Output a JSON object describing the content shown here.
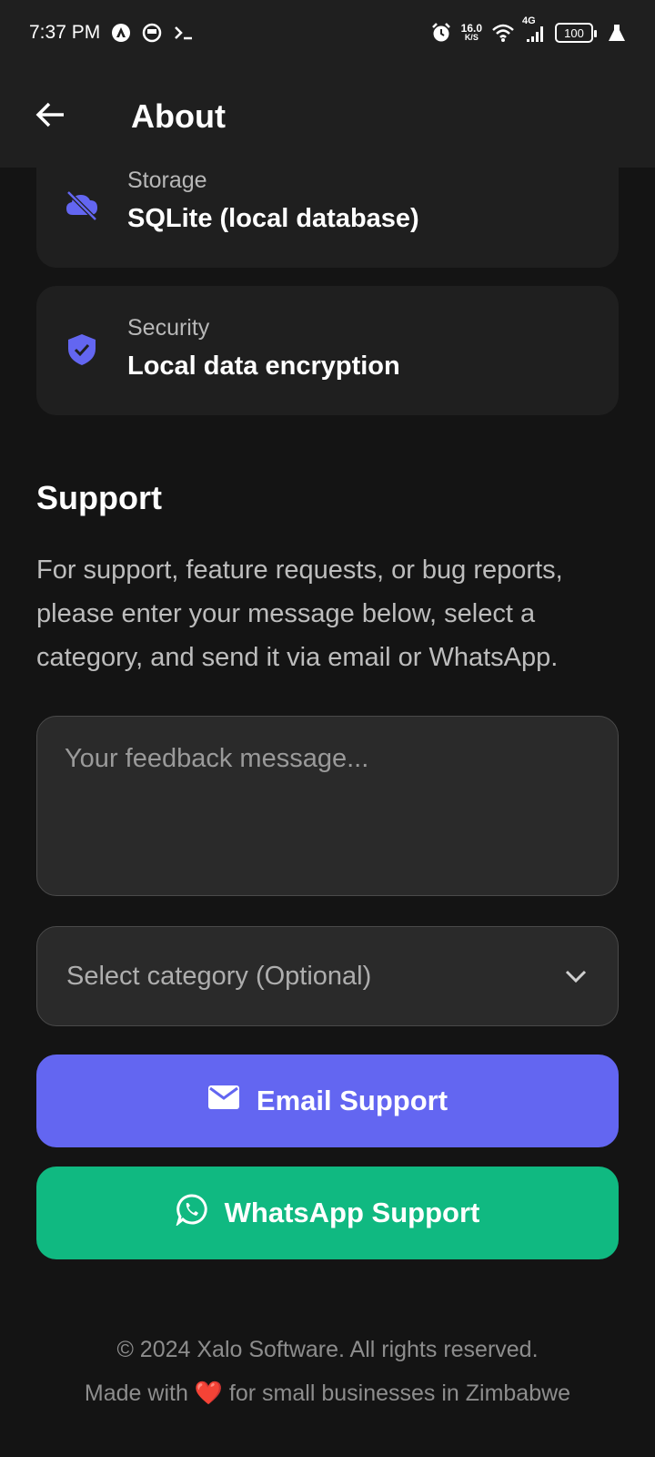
{
  "status_bar": {
    "time": "7:37 PM",
    "net_speed_value": "16.0",
    "net_speed_unit": "K/S",
    "network_type": "4G",
    "battery": "100",
    "icons": [
      "android-auto-icon",
      "app-notification-icon",
      "terminal-icon",
      "alarm-icon",
      "wifi-icon",
      "signal-icon",
      "battery-icon",
      "flask-icon"
    ]
  },
  "app_bar": {
    "title": "About",
    "back_icon": "arrow-left-icon"
  },
  "info_cards": [
    {
      "label": "Storage",
      "value": "SQLite (local database)",
      "icon": "cloud-off-icon"
    },
    {
      "label": "Security",
      "value": "Local data encryption",
      "icon": "shield-check-icon"
    }
  ],
  "support": {
    "title": "Support",
    "description": "For support, feature requests, or bug reports, please enter your message below, select a category, and send it via email or WhatsApp.",
    "feedback_placeholder": "Your feedback message...",
    "feedback_value": "",
    "category_placeholder": "Select category (Optional)",
    "email_button": "Email Support",
    "whatsapp_button": "WhatsApp Support"
  },
  "footer": {
    "copyright": "© 2024 Xalo Software. All rights reserved.",
    "made_with_prefix": "Made with",
    "heart": "❤️",
    "made_with_suffix": "for small businesses in Zimbabwe"
  },
  "colors": {
    "background": "#141414",
    "card": "#1f1f1f",
    "accent": "#6366f1",
    "whatsapp": "#10b981",
    "icon_accent": "#6366f1"
  }
}
